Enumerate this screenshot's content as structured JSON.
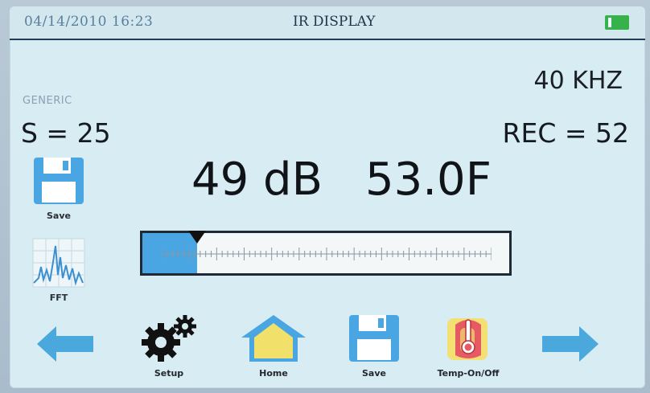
{
  "status_bar": {
    "datetime": "04/14/2010 16:23",
    "title": "IR DISPLAY",
    "battery_color": "#35b34a"
  },
  "readings": {
    "frequency": "40 KHZ",
    "model": "GENERIC",
    "sensitivity": "S = 25",
    "record": "REC = 52",
    "decibels": "49 dB",
    "temperature": "53.0F"
  },
  "meter": {
    "level_fraction": 0.15,
    "marker_fraction": 0.15,
    "fill_color": "#4aa6e3"
  },
  "side_buttons": {
    "save_label": "Save",
    "fft_label": "FFT"
  },
  "toolbar": {
    "setup_label": "Setup",
    "home_label": "Home",
    "save_label": "Save",
    "temp_label": "Temp-On/Off"
  },
  "icons": {
    "left_arrow": "arrow-left-icon",
    "right_arrow": "arrow-right-icon",
    "setup": "gears-icon",
    "home": "house-icon",
    "save": "floppy-disk-icon",
    "fft": "spectrum-icon",
    "temp": "thermometer-icon"
  },
  "colors": {
    "screen_bg": "#d7ecf3",
    "accent_blue": "#4aa6e3",
    "home_yellow": "#f1e06a",
    "temp_red": "#e65a63"
  }
}
